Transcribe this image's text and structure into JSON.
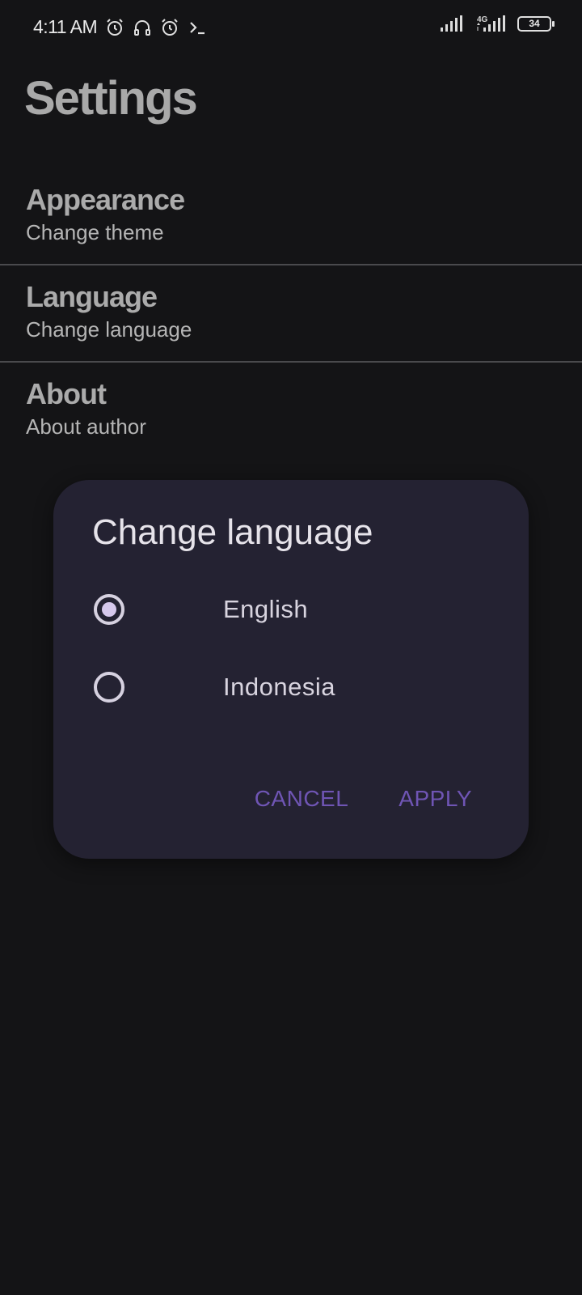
{
  "status_bar": {
    "time": "4:11 AM",
    "network_label": "4G",
    "battery": "34",
    "left_icons": [
      "alarm-icon",
      "headset-icon",
      "alarm-icon",
      "terminal-icon"
    ],
    "right_icons": [
      "signal-icon",
      "signal-4g-icon",
      "battery-icon"
    ]
  },
  "header": {
    "title": "Settings"
  },
  "settings": {
    "items": [
      {
        "title": "Appearance",
        "subtitle": "Change theme"
      },
      {
        "title": "Language",
        "subtitle": "Change language"
      },
      {
        "title": "About",
        "subtitle": "About author"
      }
    ]
  },
  "dialog": {
    "title": "Change language",
    "options": [
      {
        "label": "English",
        "selected": true
      },
      {
        "label": "Indonesia",
        "selected": false
      }
    ],
    "cancel_label": "CANCEL",
    "apply_label": "APPLY"
  },
  "colors": {
    "background": "#141416",
    "dialog_background": "#242232",
    "accent": "#6f55b4",
    "title_text": "#a9a9a9"
  }
}
